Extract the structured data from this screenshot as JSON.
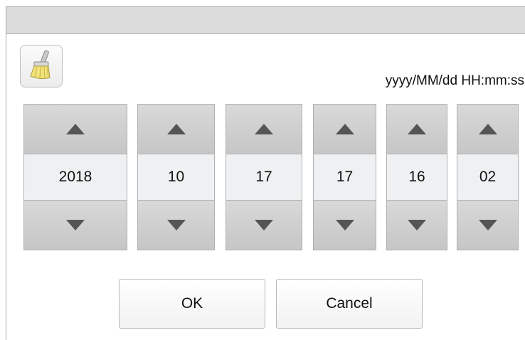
{
  "dialog": {
    "clear_icon": "broom-icon",
    "format_label": "yyyy/MM/dd HH:mm:ss",
    "fields": [
      {
        "id": "year",
        "value": "2018"
      },
      {
        "id": "month",
        "value": "10"
      },
      {
        "id": "day",
        "value": "17"
      },
      {
        "id": "hour",
        "value": "17"
      },
      {
        "id": "minute",
        "value": "16"
      },
      {
        "id": "second",
        "value": "02"
      }
    ],
    "ok_label": "OK",
    "cancel_label": "Cancel"
  }
}
